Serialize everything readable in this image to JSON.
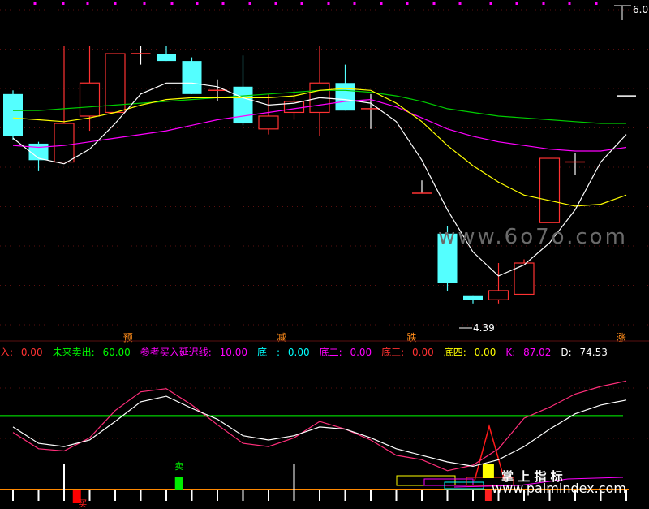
{
  "colors": {
    "background": "#000000",
    "grid": "#5a0f0f",
    "bull": "#ff3232",
    "bear": "#54ffff",
    "ma_white": "#ffffff",
    "ma_yellow": "#ffff00",
    "ma_magenta": "#ff00ff",
    "ma_green": "#00cc00",
    "k_line": "#ff2e7a",
    "d_line": "#ffffff",
    "level_line": "#00ff00",
    "bottom_band": "#ff8800"
  },
  "watermarks": [
    "www.6o7o.com",
    "www.palmindex.com",
    "掌 上 指 标"
  ],
  "chart_data": [
    {
      "type": "candlestick",
      "title": "",
      "price_labels": {
        "high": "6.0",
        "low": "4.39"
      },
      "ylim": [
        4.3,
        6.05
      ],
      "overlay_lines": [
        "white",
        "yellow",
        "magenta",
        "green"
      ],
      "candles": [
        {
          "o": 5.6,
          "c": 5.37,
          "h": 5.62,
          "l": 5.35
        },
        {
          "o": 5.33,
          "c": 5.24,
          "h": 5.34,
          "l": 5.18
        },
        {
          "o": 5.23,
          "c": 5.44,
          "h": 5.86,
          "l": 5.23
        },
        {
          "o": 5.48,
          "c": 5.66,
          "h": 5.86,
          "l": 5.4
        },
        {
          "o": 5.5,
          "c": 5.82,
          "h": 5.82,
          "l": 5.5
        },
        {
          "o": 5.82,
          "c": 5.82,
          "h": 5.86,
          "l": 5.76
        },
        {
          "o": 5.82,
          "c": 5.78,
          "h": 5.86,
          "l": 5.78
        },
        {
          "o": 5.78,
          "c": 5.6,
          "h": 5.8,
          "l": 5.6
        },
        {
          "o": 5.62,
          "c": 5.62,
          "h": 5.68,
          "l": 5.56
        },
        {
          "o": 5.64,
          "c": 5.44,
          "h": 5.81,
          "l": 5.43
        },
        {
          "o": 5.41,
          "c": 5.48,
          "h": 5.6,
          "l": 5.38
        },
        {
          "o": 5.5,
          "c": 5.56,
          "h": 5.62,
          "l": 5.46
        },
        {
          "o": 5.5,
          "c": 5.66,
          "h": 5.86,
          "l": 5.37
        },
        {
          "o": 5.66,
          "c": 5.51,
          "h": 5.76,
          "l": 5.51
        },
        {
          "o": 5.52,
          "c": 5.52,
          "h": 5.6,
          "l": 5.41
        },
        {
          "o": null,
          "c": null,
          "h": null,
          "l": null
        },
        {
          "o": 5.06,
          "c": 5.06,
          "h": 5.13,
          "l": 5.06
        },
        {
          "o": 4.84,
          "c": 4.57,
          "h": 4.88,
          "l": 4.53
        },
        {
          "o": 4.5,
          "c": 4.48,
          "h": 4.5,
          "l": 4.46
        },
        {
          "o": 4.48,
          "c": 4.53,
          "h": 4.68,
          "l": 4.46
        },
        {
          "o": 4.51,
          "c": 4.68,
          "h": 4.7,
          "l": 4.51
        },
        {
          "o": 4.9,
          "c": 5.25,
          "h": 5.25,
          "l": 4.9
        },
        {
          "o": 5.22,
          "c": 5.23,
          "h": 5.28,
          "l": 5.16
        },
        {
          "o": null,
          "c": null,
          "h": null,
          "l": null
        },
        {
          "o": 5.59,
          "c": 5.59,
          "h": 5.59,
          "l": 5.59
        }
      ],
      "ma_white": [
        5.36,
        5.25,
        5.22,
        5.3,
        5.44,
        5.6,
        5.66,
        5.66,
        5.64,
        5.58,
        5.54,
        5.55,
        5.58,
        5.57,
        5.55,
        5.45,
        5.24,
        4.97,
        4.74,
        4.61,
        4.67,
        4.79,
        4.97,
        5.23,
        5.38
      ],
      "ma_yellow": [
        5.47,
        5.46,
        5.45,
        5.47,
        5.5,
        5.54,
        5.57,
        5.58,
        5.58,
        5.58,
        5.58,
        5.59,
        5.62,
        5.63,
        5.62,
        5.55,
        5.45,
        5.32,
        5.21,
        5.12,
        5.05,
        5.02,
        4.99,
        5.0,
        5.05
      ],
      "ma_magenta": [
        5.32,
        5.31,
        5.32,
        5.34,
        5.36,
        5.38,
        5.4,
        5.43,
        5.46,
        5.48,
        5.5,
        5.52,
        5.54,
        5.56,
        5.57,
        5.53,
        5.47,
        5.41,
        5.37,
        5.34,
        5.32,
        5.3,
        5.29,
        5.29,
        5.31
      ],
      "ma_green": [
        5.51,
        5.51,
        5.52,
        5.53,
        5.54,
        5.55,
        5.56,
        5.57,
        5.58,
        5.59,
        5.6,
        5.61,
        5.62,
        5.62,
        5.61,
        5.59,
        5.56,
        5.52,
        5.5,
        5.48,
        5.47,
        5.46,
        5.45,
        5.44,
        5.44
      ],
      "annotations": [
        {
          "label": "预",
          "index": 4.5
        },
        {
          "label": "减",
          "index": 10.5
        },
        {
          "label": "跌",
          "index": 15.6
        },
        {
          "label": "涨",
          "index": 23.8
        }
      ]
    },
    {
      "type": "line",
      "title": "",
      "ylim": [
        -5,
        110
      ],
      "legend": [
        {
          "label": "入: ",
          "value": "0.00",
          "color": "#ff3232"
        },
        {
          "label": "未来卖出: ",
          "value": "60.00",
          "color": "#00ff00"
        },
        {
          "label": "参考买入延迟线: ",
          "value": "10.00",
          "color": "#ff00ff"
        },
        {
          "label": "底一: ",
          "value": "0.00",
          "color": "#00ffff"
        },
        {
          "label": "底二: ",
          "value": "0.00",
          "color": "#ff00ff"
        },
        {
          "label": "底三: ",
          "value": "0.00",
          "color": "#ff3232"
        },
        {
          "label": "底四: ",
          "value": "0.00",
          "color": "#ffff00"
        },
        {
          "label": "K: ",
          "value": "87.02",
          "color": "#ff00ff"
        },
        {
          "label": "D: ",
          "value": "74.53",
          "color": "#ffffff"
        }
      ],
      "level": 60,
      "series": [
        {
          "name": "K",
          "values": [
            45,
            30,
            28,
            40,
            65,
            82,
            85,
            70,
            52,
            35,
            32,
            40,
            55,
            48,
            38,
            24,
            20,
            10,
            15,
            30,
            58,
            68,
            80,
            87,
            92
          ]
        },
        {
          "name": "D",
          "values": [
            50,
            35,
            32,
            38,
            55,
            73,
            78,
            67,
            57,
            42,
            38,
            42,
            50,
            48,
            40,
            30,
            24,
            18,
            14,
            20,
            32,
            48,
            62,
            70,
            74.53
          ]
        }
      ],
      "markers": [
        {
          "label": "买",
          "index": 2.5,
          "color": "#ff0000"
        },
        {
          "label": "卖",
          "index": 6.5,
          "color": "#00ee00"
        },
        {
          "label": "",
          "index": 18.6,
          "color": "#ffff00"
        }
      ]
    }
  ]
}
